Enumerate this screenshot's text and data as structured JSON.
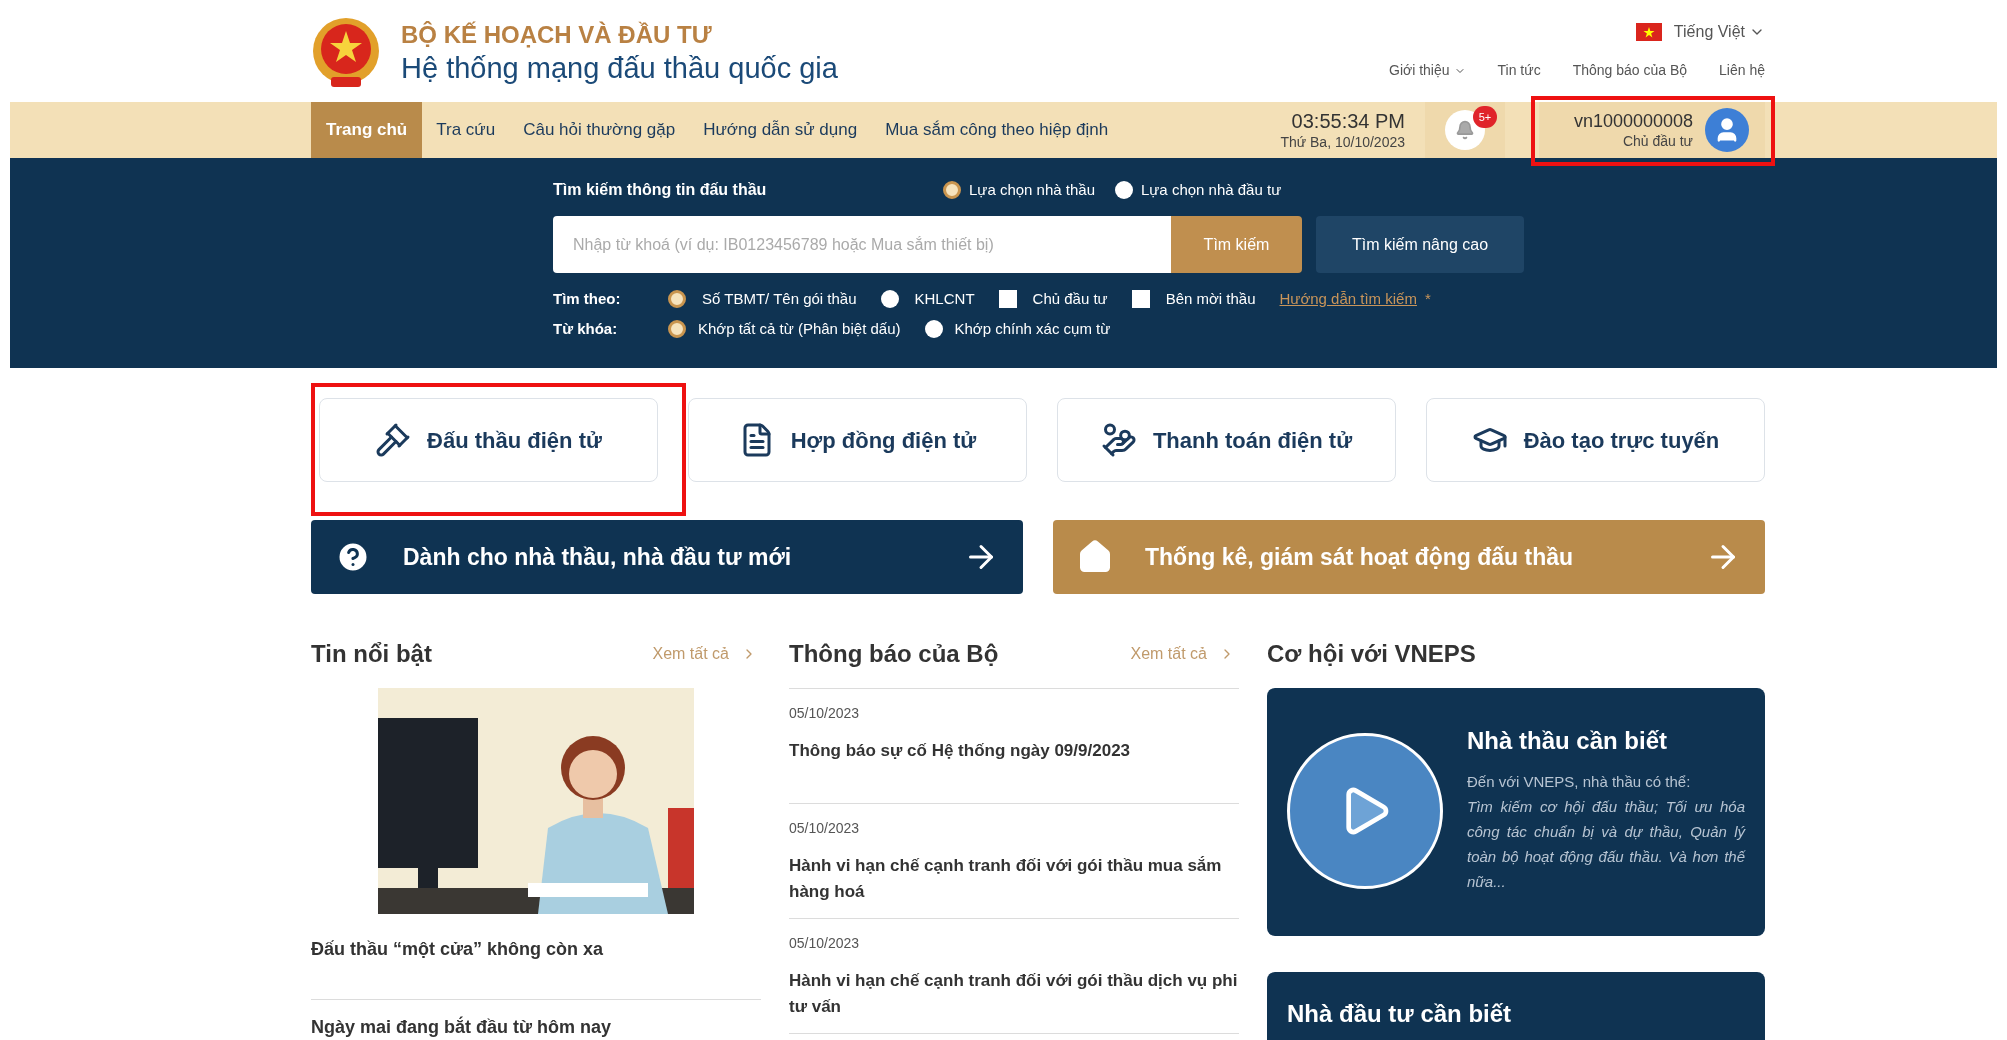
{
  "header": {
    "ministry": "BỘ KẾ HOẠCH VÀ ĐẦU TƯ",
    "system_name": "Hệ thống mạng đấu thầu quốc gia",
    "language": "Tiếng Việt",
    "top_links": [
      {
        "label": "Giới thiệu",
        "kind": "dropdown"
      },
      {
        "label": "Tin tức",
        "kind": "link"
      },
      {
        "label": "Thông báo của Bộ",
        "kind": "link"
      },
      {
        "label": "Liên hệ",
        "kind": "link"
      }
    ]
  },
  "nav": {
    "items": [
      {
        "label": "Trang chủ",
        "selected": true
      },
      {
        "label": "Tra cứu",
        "selected": false
      },
      {
        "label": "Câu hỏi thường gặp",
        "selected": false
      },
      {
        "label": "Hướng dẫn sử dụng",
        "selected": false
      },
      {
        "label": "Mua sắm công theo hiệp định",
        "selected": false
      }
    ],
    "clock": {
      "time": "03:55:34 PM",
      "date": "Thứ Ba, 10/10/2023"
    },
    "notification_badge": "5+",
    "user": {
      "id": "vn1000000008",
      "role": "Chủ đầu tư",
      "highlighted": true
    }
  },
  "search": {
    "title": "Tìm kiếm thông tin đấu thầu",
    "modes": [
      {
        "label": "Lựa chọn nhà thầu",
        "selected": true
      },
      {
        "label": "Lựa chọn nhà đầu tư",
        "selected": false
      }
    ],
    "placeholder": "Nhập từ khoá (ví dụ: IB0123456789 hoặc Mua sắm thiết bị)",
    "search_button": "Tìm kiếm",
    "advanced_button": "Tìm kiếm nâng cao",
    "filter_label": "Tìm theo:",
    "filters": [
      {
        "label": "Số TBMT/ Tên gói thầu",
        "kind": "radio",
        "selected": true
      },
      {
        "label": "KHLCNT",
        "kind": "radio",
        "selected": false
      },
      {
        "label": "Chủ đầu tư",
        "kind": "checkbox",
        "checked": false
      },
      {
        "label": "Bên mời thầu",
        "kind": "checkbox",
        "checked": false
      }
    ],
    "help_link": "Hướng dẫn tìm kiếm",
    "help_mark": "*",
    "keyword_label": "Từ khóa:",
    "keyword_options": [
      {
        "label": "Khớp tất cả từ (Phân biệt dấu)",
        "selected": true
      },
      {
        "label": "Khớp chính xác cụm từ",
        "selected": false
      }
    ]
  },
  "services": [
    {
      "label": "Đấu thầu điện tử",
      "kind": "gavel",
      "highlighted": true
    },
    {
      "label": "Hợp đồng điện tử",
      "kind": "contract",
      "highlighted": false
    },
    {
      "label": "Thanh toán điện tử",
      "kind": "payment",
      "highlighted": false
    },
    {
      "label": "Đào tạo trực tuyến",
      "kind": "training",
      "highlighted": false
    }
  ],
  "banners": [
    {
      "label": "Dành cho nhà thầu, nhà đầu tư mới",
      "kind": "help"
    },
    {
      "label": "Thống kê, giám sát hoạt động đấu thầu",
      "kind": "home"
    }
  ],
  "news": {
    "title": "Tin nổi bật",
    "view_all": "Xem tất cả",
    "items": [
      "Đấu thầu “một cửa” không còn xa",
      "Ngày mai đang bắt đầu từ hôm nay"
    ]
  },
  "notices": {
    "title": "Thông báo của Bộ",
    "view_all": "Xem tất cả",
    "items": [
      {
        "date": "05/10/2023",
        "title": "Thông báo sự cố Hệ thống ngày 09/9/2023"
      },
      {
        "date": "05/10/2023",
        "title": "Hành vi hạn chế cạnh tranh đối với gói thầu mua sắm hàng hoá"
      },
      {
        "date": "05/10/2023",
        "title": "Hành vi hạn chế cạnh tranh đối với gói thầu dịch vụ phi tư vấn"
      }
    ]
  },
  "opportunities": {
    "title": "Cơ hội với VNEPS",
    "cards": [
      {
        "title": "Nhà thầu cần biết",
        "intro": "Đến với VNEPS, nhà thầu có thể:",
        "body": "Tìm kiếm cơ hội đấu thầu; Tối ưu hóa công tác chuẩn bị và dự thầu, Quản lý toàn bộ hoạt động đấu thầu. Và hơn thế nữa..."
      },
      {
        "title": "Nhà đầu tư cần biết"
      }
    ]
  }
}
